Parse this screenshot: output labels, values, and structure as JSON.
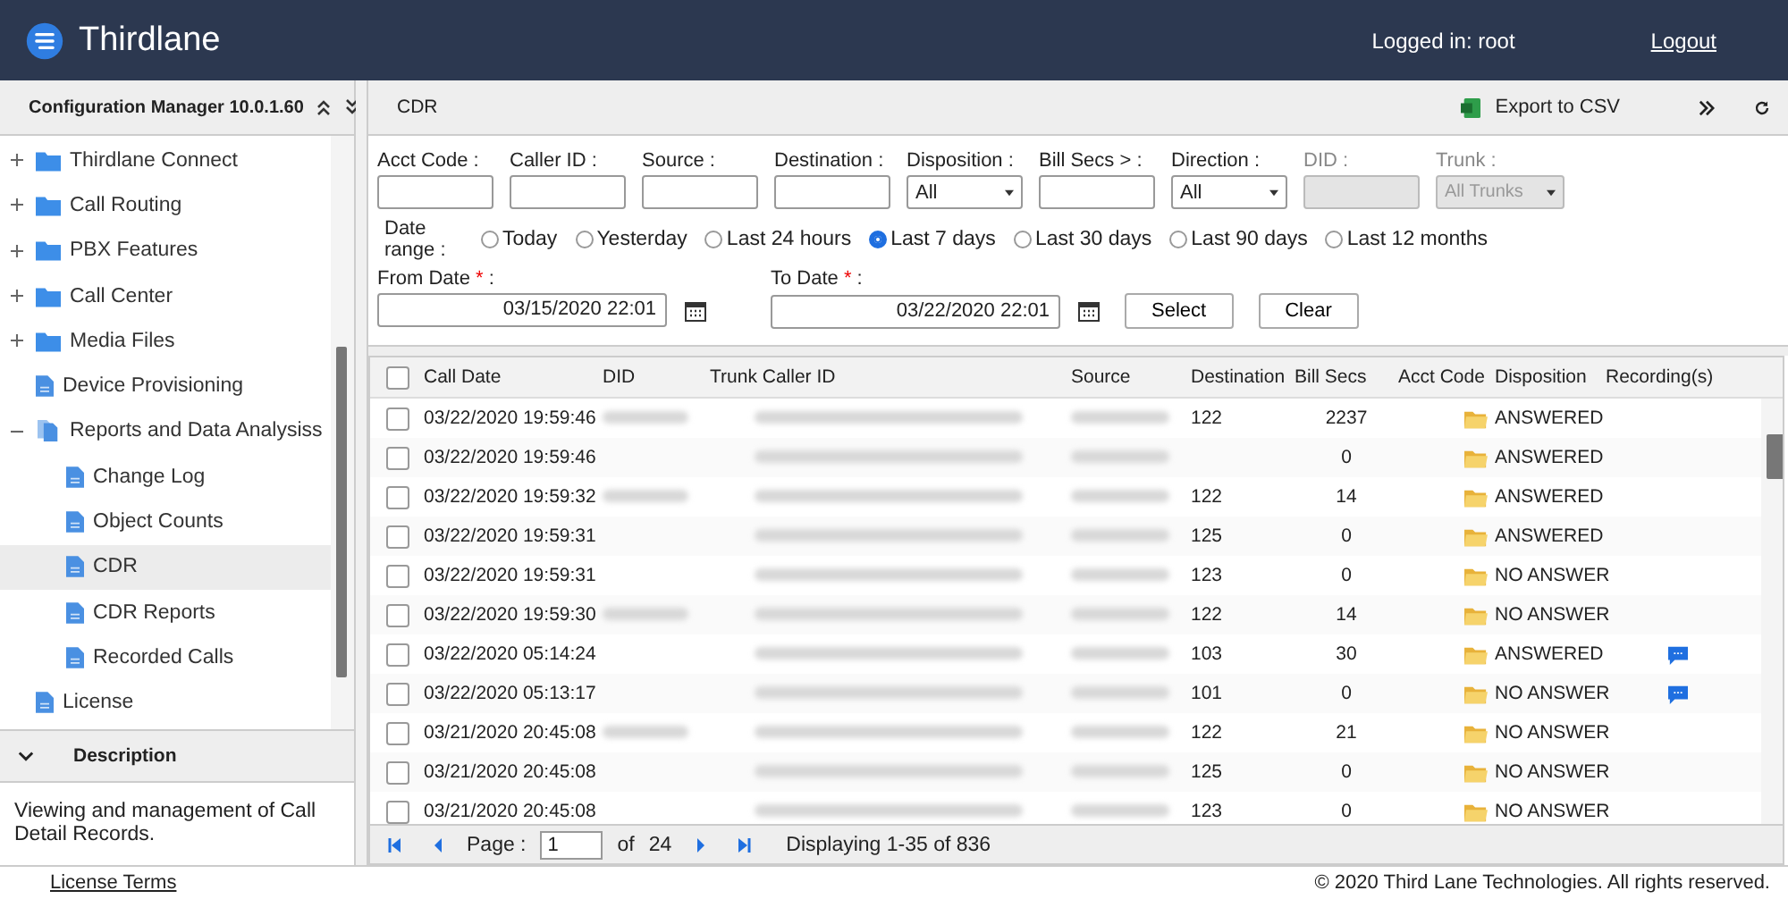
{
  "header": {
    "app_name": "Thirdlane",
    "user_label": "Logged in: root",
    "logout": "Logout"
  },
  "sidebar": {
    "title": "Configuration Manager 10.0.1.60",
    "tree": [
      {
        "label": "Thirdlane Connect",
        "kind": "folder",
        "expanded": false,
        "selected": false
      },
      {
        "label": "Call Routing",
        "kind": "folder",
        "expanded": false,
        "selected": false
      },
      {
        "label": "PBX Features",
        "kind": "folder",
        "expanded": false,
        "selected": false
      },
      {
        "label": "Call Center",
        "kind": "folder",
        "expanded": false,
        "selected": false
      },
      {
        "label": "Media Files",
        "kind": "folder",
        "expanded": false,
        "selected": false
      },
      {
        "label": "Device Provisioning",
        "kind": "doc",
        "selected": false
      },
      {
        "label": "Reports and Data Analysiss",
        "kind": "docs",
        "expanded": true,
        "selected": false,
        "children": [
          {
            "label": "Change Log",
            "kind": "doc",
            "selected": false
          },
          {
            "label": "Object Counts",
            "kind": "doc",
            "selected": false
          },
          {
            "label": "CDR",
            "kind": "doc",
            "selected": true
          },
          {
            "label": "CDR Reports",
            "kind": "doc",
            "selected": false
          },
          {
            "label": "Recorded Calls",
            "kind": "doc",
            "selected": false
          }
        ]
      },
      {
        "label": "License",
        "kind": "doc",
        "selected": false
      }
    ],
    "description_title": "Description",
    "description": "Viewing and management of Call Detail Records."
  },
  "panel": {
    "title": "CDR",
    "export": "Export to CSV"
  },
  "filters": [
    {
      "label": "Acct Code :",
      "kind": "text",
      "disabled": false
    },
    {
      "label": "Caller ID :",
      "kind": "text",
      "disabled": false
    },
    {
      "label": "Source :",
      "kind": "text",
      "disabled": false
    },
    {
      "label": "Destination :",
      "kind": "text",
      "disabled": false
    },
    {
      "label": "Disposition :",
      "kind": "select",
      "value": "All",
      "disabled": false
    },
    {
      "label": "Bill Secs > :",
      "kind": "text",
      "disabled": false
    },
    {
      "label": "Direction :",
      "kind": "select",
      "value": "All",
      "disabled": false
    },
    {
      "label": "DID :",
      "kind": "text",
      "disabled": true
    },
    {
      "label": "Trunk :",
      "kind": "select",
      "value": "All Trunks",
      "disabled": true
    }
  ],
  "date_range": {
    "label": "Date range :",
    "options": [
      {
        "label": "Today",
        "selected": false
      },
      {
        "label": "Yesterday",
        "selected": false
      },
      {
        "label": "Last 24 hours",
        "selected": false
      },
      {
        "label": "Last 7 days",
        "selected": true
      },
      {
        "label": "Last 30 days",
        "selected": false
      },
      {
        "label": "Last 90 days",
        "selected": false
      },
      {
        "label": "Last 12 months",
        "selected": false
      }
    ]
  },
  "from_date": {
    "label": "From Date",
    "required_mark": "*",
    "label_end": ":",
    "value": "03/15/2020 22:01"
  },
  "to_date": {
    "label": "To Date",
    "required_mark": "*",
    "label_end": ":",
    "value": "03/22/2020 22:01"
  },
  "buttons": [
    "Select",
    "Clear"
  ],
  "table": {
    "all_checked": false,
    "columns": [
      "Call Date",
      "DID",
      "Trunk Caller ID",
      "Source",
      "Destination",
      "Bill Secs",
      "Acct Code",
      "Disposition",
      "Recording(s)"
    ],
    "rows": [
      {
        "date": "03/22/2020 19:59:46",
        "did": true,
        "destination": "122",
        "bill_secs": "2237",
        "disposition": "ANSWERED",
        "recording": false,
        "checked": false
      },
      {
        "date": "03/22/2020 19:59:46",
        "did": false,
        "destination": "",
        "bill_secs": "0",
        "disposition": "ANSWERED",
        "recording": false,
        "checked": false
      },
      {
        "date": "03/22/2020 19:59:32",
        "did": true,
        "destination": "122",
        "bill_secs": "14",
        "disposition": "ANSWERED",
        "recording": false,
        "checked": false
      },
      {
        "date": "03/22/2020 19:59:31",
        "did": false,
        "destination": "125",
        "bill_secs": "0",
        "disposition": "ANSWERED",
        "recording": false,
        "checked": false
      },
      {
        "date": "03/22/2020 19:59:31",
        "did": false,
        "destination": "123",
        "bill_secs": "0",
        "disposition": "NO ANSWER",
        "recording": false,
        "checked": false
      },
      {
        "date": "03/22/2020 19:59:30",
        "did": true,
        "destination": "122",
        "bill_secs": "14",
        "disposition": "NO ANSWER",
        "recording": false,
        "checked": false
      },
      {
        "date": "03/22/2020 05:14:24",
        "did": false,
        "destination": "103",
        "bill_secs": "30",
        "disposition": "ANSWERED",
        "recording": true,
        "checked": false
      },
      {
        "date": "03/22/2020 05:13:17",
        "did": false,
        "destination": "101",
        "bill_secs": "0",
        "disposition": "NO ANSWER",
        "recording": true,
        "checked": false
      },
      {
        "date": "03/21/2020 20:45:08",
        "did": true,
        "destination": "122",
        "bill_secs": "21",
        "disposition": "NO ANSWER",
        "recording": false,
        "checked": false
      },
      {
        "date": "03/21/2020 20:45:08",
        "did": false,
        "destination": "125",
        "bill_secs": "0",
        "disposition": "NO ANSWER",
        "recording": false,
        "checked": false
      },
      {
        "date": "03/21/2020 20:45:08",
        "did": false,
        "destination": "123",
        "bill_secs": "0",
        "disposition": "NO ANSWER",
        "recording": false,
        "checked": false
      }
    ]
  },
  "pager": {
    "page_label": "Page :",
    "page": "1",
    "of": "of",
    "total_pages": "24",
    "display": "Displaying 1-35 of 836"
  },
  "footer": {
    "link": "License Terms",
    "copyright": "© 2020 Third Lane Technologies. All rights reserved."
  }
}
